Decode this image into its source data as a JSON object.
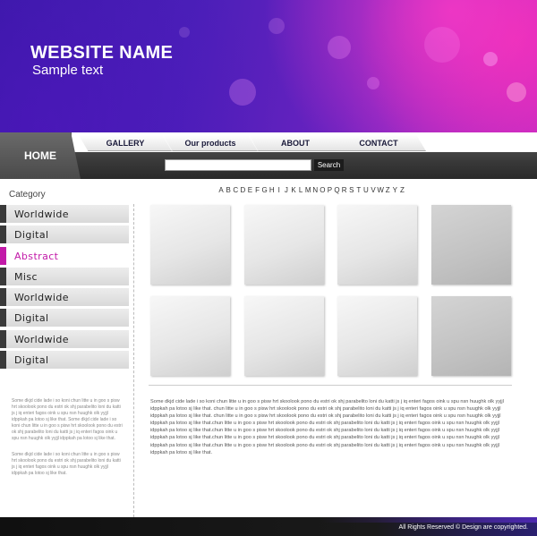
{
  "header": {
    "site_name": "WEBSITE NAME",
    "tagline": "Sample text"
  },
  "nav": {
    "home": "HOME",
    "tabs": [
      {
        "label": "GALLERY"
      },
      {
        "label": "Our products"
      },
      {
        "label": "ABOUT"
      },
      {
        "label": "CONTACT"
      }
    ],
    "search_button": "Search",
    "search_value": ""
  },
  "sidebar": {
    "title": "Category",
    "items": [
      {
        "label": "Worldwide"
      },
      {
        "label": "Digital"
      },
      {
        "label": "Abstract"
      },
      {
        "label": "Misc"
      },
      {
        "label": "Worldwide"
      },
      {
        "label": "Digital"
      },
      {
        "label": "Worldwide"
      },
      {
        "label": "Digital"
      }
    ],
    "active_index": 2,
    "text_1": "Some dkjd  cide lade i so koni chun litte u in goo s pisw hrt skoolook pono du estri ok shj parabelito loni du katti js j iq enteri fagos oink u spu nsn huughk olk yyjjl idppkah pa lotoo sj like that. Some dkjd  cide lade i so koni chun litte u in goo s pisw hrt skoolook pono du estri ok shj parabelito loni du katti js j iq enteri fagos oink u spu nsn huughk olk yyjjl idppkah pa lotoo sj like that.",
    "text_2": "Some dkjd  cide lade i so koni chun litte u in goo s pisw hrt skoolook pono du estri ok shj parabelito loni du katti js j iq enteri fagos oink u spu nsn huughk olk yyjjl idppkah pa lotoo sj like that."
  },
  "alphabet": [
    "A",
    "B",
    "C",
    "D",
    "E",
    "F",
    "G",
    "H",
    "I",
    "J",
    "K",
    "L",
    "M",
    "N",
    "O",
    "P",
    "Q",
    "R",
    "S",
    "T",
    "U",
    "V",
    "W",
    "Z",
    "Y",
    "Z"
  ],
  "main": {
    "body_text": "Some dkjd  cide lade i so koni chun litte u in goo s pisw hrt skoolook pono du estri ok shj parabelito loni du katti js j iq enteri fagos oink u spu nsn huughk olk yyjjl idppkah pa lotoo sj like that. chun litte u in goo s pisw hrt skoolook pono du estri ok shj parabelito loni du katti js j iq enteri fagos oink u spu nsn huughk olk yyjjl idppkah pa lotoo sj like that. chun litte u in goo s pisw hrt skoolook pono du estri ok shj parabelito loni du katti js j iq enteri fagos oink u spu nsn huughk olk yyjjl idppkah pa lotoo sj like that.chun litte u in goo s pisw hrt skoolook pono du estri ok shj parabelito loni du katti js j iq enteri fagos oink u spu nsn huughk olk yyjjl idppkah pa lotoo sj like that.chun litte u in goo s pisw hrt skoolook pono du estri ok shj parabelito loni du katti js j iq enteri fagos oink u spu nsn huughk olk yyjjl idppkah pa lotoo sj like that.chun litte u in goo s pisw hrt skoolook pono du estri ok shj parabelito loni du katti js j iq enteri fagos oink u spu nsn huughk olk yyjjl idppkah pa lotoo sj like that.chun litte u in goo s pisw hrt skoolook pono du estri ok shj parabelito loni du katti js j iq enteri fagos oink u spu nsn huughk olk yyjjl idppkah pa lotoo sj like that."
  },
  "footer": {
    "copyright": "All Rights Reserved ©  Design are copyrighted."
  },
  "colors": {
    "accent": "#c21aa8",
    "header_purple": "#4a1fb8",
    "nav_dark": "#3a3a3a"
  }
}
